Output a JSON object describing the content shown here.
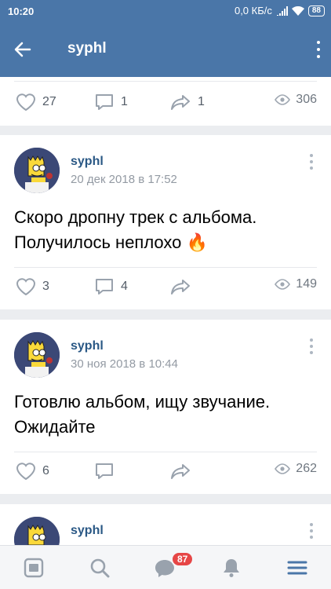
{
  "status_bar": {
    "time": "10:20",
    "network_speed": "0,0 КБ/с",
    "battery": "88"
  },
  "header": {
    "title": "syphl",
    "back_icon": "arrow-left-icon",
    "menu_icon": "more-vertical-icon"
  },
  "partial_post": {
    "likes": "27",
    "comments": "1",
    "shares": "1",
    "views": "306"
  },
  "posts": [
    {
      "author": "syphl",
      "date": "20 дек 2018 в 17:52",
      "text": "Скоро дропну трек с альбома. Получилось неплохо 🔥",
      "likes": "3",
      "comments": "4",
      "shares": "",
      "views": "149"
    },
    {
      "author": "syphl",
      "date": "30 ноя 2018 в 10:44",
      "text": "Готовлю альбом, ищу звучание. Ожидайте",
      "likes": "6",
      "comments": "",
      "shares": "",
      "views": "262"
    },
    {
      "author": "syphl"
    }
  ],
  "bottom_nav": {
    "items": [
      "news-icon",
      "search-icon",
      "messages-icon",
      "notifications-icon",
      "menu-icon"
    ],
    "messages_badge": "87"
  },
  "colors": {
    "brand": "#4a76a8",
    "link": "#2a5885",
    "badge": "#e64646",
    "active_nav": "#4a76a8"
  }
}
